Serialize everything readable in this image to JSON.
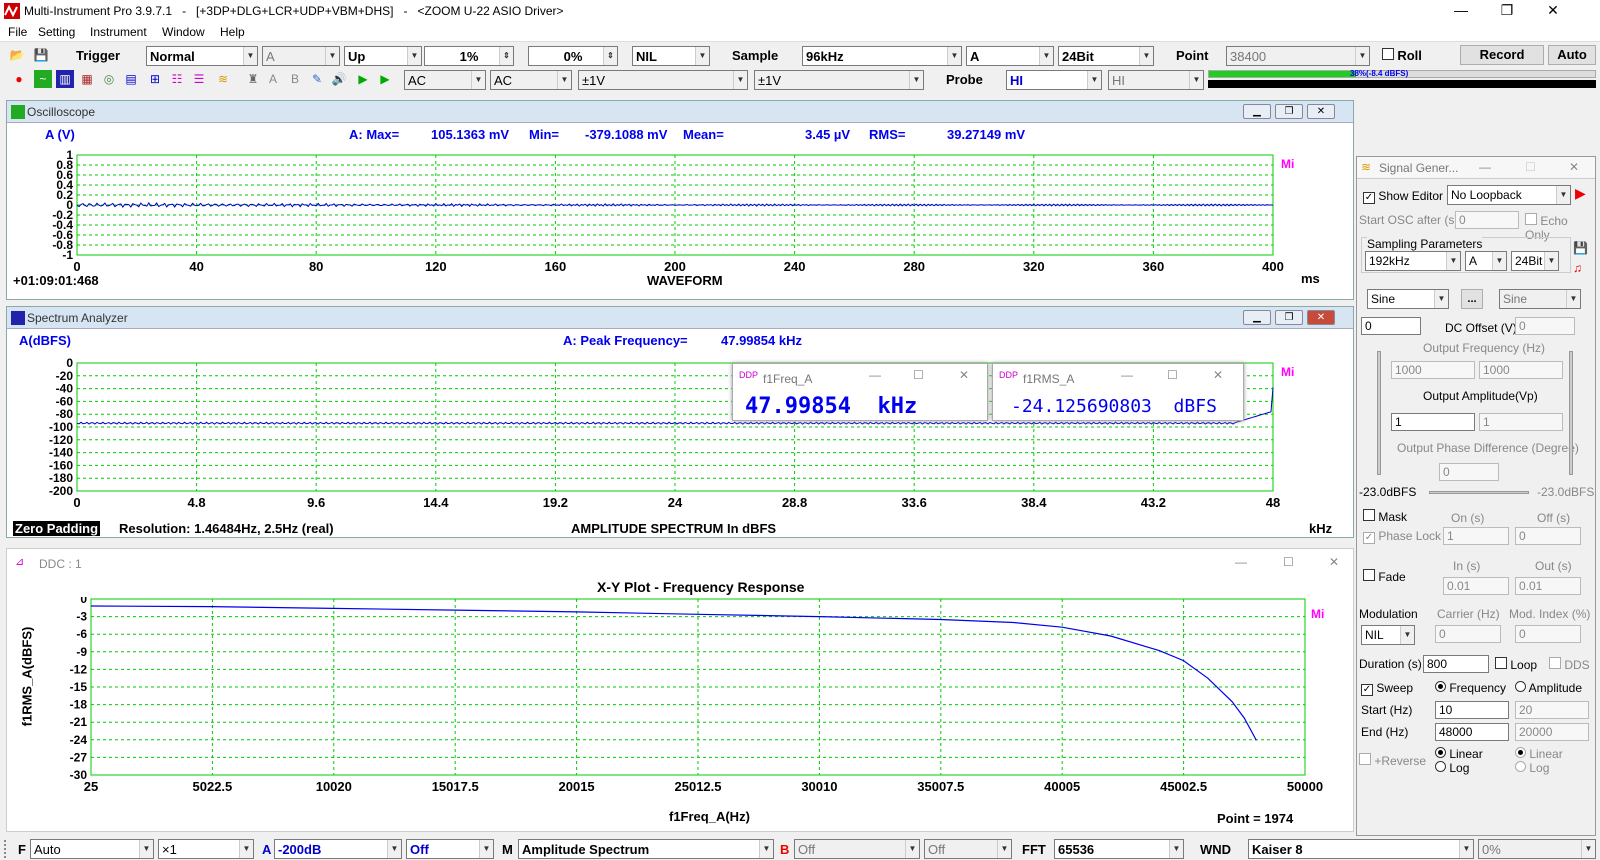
{
  "window": {
    "title": "Multi-Instrument Pro 3.9.7.1   -   [+3DP+DLG+LCR+UDP+VBM+DHS]   -   <ZOOM U-22 ASIO Driver>"
  },
  "menu": [
    "File",
    "Setting",
    "Instrument",
    "Window",
    "Help"
  ],
  "toolbar1": {
    "trigger_label": "Trigger",
    "trigger_mode": "Normal",
    "trigger_channel": "A",
    "trigger_edge": "Up",
    "trigger_level": "1%",
    "trigger_delay": "0%",
    "trigger_extra": "NIL",
    "sample_label": "Sample",
    "sample_rate": "96kHz",
    "sample_channel": "A",
    "bit_depth": "24Bit",
    "point_label": "Point",
    "point_value": "38400",
    "roll_label": "Roll",
    "record_label": "Record",
    "auto_label": "Auto"
  },
  "toolbar2": {
    "coupling_a": "AC",
    "coupling_b": "AC",
    "range_a": "±1V",
    "range_b": "±1V",
    "probe_label": "Probe",
    "probe_a": "HI",
    "probe_b": "HI",
    "level_text": "38%(-8.4 dBFS)",
    "level_fraction": 0.38
  },
  "oscilloscope": {
    "title": "Oscilloscope",
    "channel": "A (V)",
    "max_label": "A: Max=",
    "max_value": "105.1363 mV",
    "min_label": "Min=",
    "min_value": "-379.1088 mV",
    "mean_label": "Mean=",
    "mean_value": "3.45  µV",
    "rms_label": "RMS=",
    "rms_value": "39.27149 mV",
    "yticks": [
      "1",
      "0.8",
      "0.6",
      "0.4",
      "0.2",
      "0",
      "-0.2",
      "-0.4",
      "-0.6",
      "-0.8",
      "-1"
    ],
    "xticks": [
      "0",
      "40",
      "80",
      "120",
      "160",
      "200",
      "240",
      "280",
      "320",
      "360",
      "400"
    ],
    "xunit": "ms",
    "time": "+01:09:01:468",
    "xtitle": "WAVEFORM",
    "logo": "Mi"
  },
  "spectrum": {
    "title": "Spectrum Analyzer",
    "channel": "A(dBFS)",
    "peak_label": "A: Peak Frequency=",
    "peak_value": "47.99854  kHz",
    "yticks": [
      "0",
      "-20",
      "-40",
      "-60",
      "-80",
      "-100",
      "-120",
      "-140",
      "-160",
      "-180",
      "-200"
    ],
    "xticks": [
      "0",
      "4.8",
      "9.6",
      "14.4",
      "19.2",
      "24",
      "28.8",
      "33.6",
      "38.4",
      "43.2",
      "48"
    ],
    "xunit": "kHz",
    "zero_padding": "Zero Padding",
    "resolution": "Resolution: 1.46484Hz, 2.5Hz (real)",
    "xtitle": "AMPLITUDE SPECTRUM In dBFS",
    "logo": "Mi"
  },
  "ddp1": {
    "title": "f1Freq_A",
    "value": "47.99854  kHz"
  },
  "ddp2": {
    "title": "f1RMS_A",
    "value": "-24.125690803  dBFS"
  },
  "xy": {
    "title": "DDC : 1",
    "logo": "Mi"
  },
  "chart_data": {
    "type": "line",
    "title": "X-Y Plot - Frequency Response",
    "xlabel": "f1Freq_A(Hz)",
    "ylabel": "f1RMS_A(dBFS)",
    "xlim": [
      25,
      50000
    ],
    "ylim": [
      -30,
      0
    ],
    "xticks": [
      "25",
      "5022.5",
      "10020",
      "15017.5",
      "20015",
      "25012.5",
      "30010",
      "35007.5",
      "40005",
      "45002.5",
      "50000"
    ],
    "yticks": [
      "0",
      "-3",
      "-6",
      "-9",
      "-12",
      "-15",
      "-18",
      "-21",
      "-24",
      "-27",
      "-30"
    ],
    "point_count": "Point = 1974",
    "series": [
      {
        "x": [
          25,
          5000,
          10000,
          15000,
          20000,
          25000,
          30000,
          35000,
          38000,
          40000,
          42000,
          44000,
          45000,
          46000,
          47000,
          47500,
          48000
        ],
        "y": [
          -1.2,
          -1.3,
          -1.6,
          -1.9,
          -2.2,
          -2.6,
          -3.0,
          -3.5,
          -4.0,
          -4.8,
          -6.3,
          -8.8,
          -10.5,
          -13.5,
          -17.5,
          -20.3,
          -24.1
        ]
      }
    ]
  },
  "signal_generator": {
    "title": "Signal Gener...",
    "show_editor": "Show Editor",
    "loopback": "No Loopback",
    "start_osc": "Start OSC after (s)",
    "start_osc_value": "0",
    "echo_only": "Echo Only",
    "sampling_params": "Sampling Parameters",
    "rate": "192kHz",
    "channel": "A",
    "bits": "24Bit",
    "wave1": "Sine",
    "wave2": "Sine",
    "dots": "...",
    "dc_value": "0",
    "dc_label": "DC Offset (V)",
    "dc_value2": "0",
    "out_freq_label": "Output Frequency (Hz)",
    "freq1": "1000",
    "freq2": "1000",
    "out_amp_label": "Output Amplitude(Vp)",
    "amp1": "1",
    "amp2": "1",
    "phase_label": "Output Phase Difference (Degree)",
    "phase": "0",
    "level_left": "-23.0dBFS",
    "level_right": "-23.0dBFS",
    "mask": "Mask",
    "on_label": "On (s)",
    "off_label": "Off (s)",
    "phase_lock": "Phase Lock",
    "on_value": "1",
    "off_value": "0",
    "fade": "Fade",
    "in_label": "In (s)",
    "out_label": "Out (s)",
    "in_value": "0.01",
    "out_value": "0.01",
    "modulation": "Modulation",
    "carrier": "Carrier (Hz)",
    "mod_index": "Mod. Index (%)",
    "mod_value": "NIL",
    "carrier_value": "0",
    "index_value": "0",
    "duration_label": "Duration (s)",
    "duration": "800",
    "loop": "Loop",
    "dds": "DDS",
    "sweep": "Sweep",
    "frequency": "Frequency",
    "amplitude": "Amplitude",
    "start_label": "Start (Hz)",
    "start1": "10",
    "start2": "20",
    "end_label": "End (Hz)",
    "end1": "48000",
    "end2": "20000",
    "reverse": "+Reverse",
    "linear": "Linear",
    "log": "Log",
    "linear2": "Linear",
    "log2": "Log"
  },
  "bottombar": {
    "f_label": "F",
    "f_value": "Auto",
    "mult": "×1",
    "a_label": "A",
    "a_value": "-200dB",
    "a_off": "Off",
    "m_label": "M",
    "m_value": "Amplitude Spectrum",
    "b_label": "B",
    "b_off1": "Off",
    "b_off2": "Off",
    "fft_label": "FFT",
    "fft_value": "65536",
    "wnd_label": "WND",
    "wnd_value": "Kaiser 8",
    "pct": "0%"
  }
}
